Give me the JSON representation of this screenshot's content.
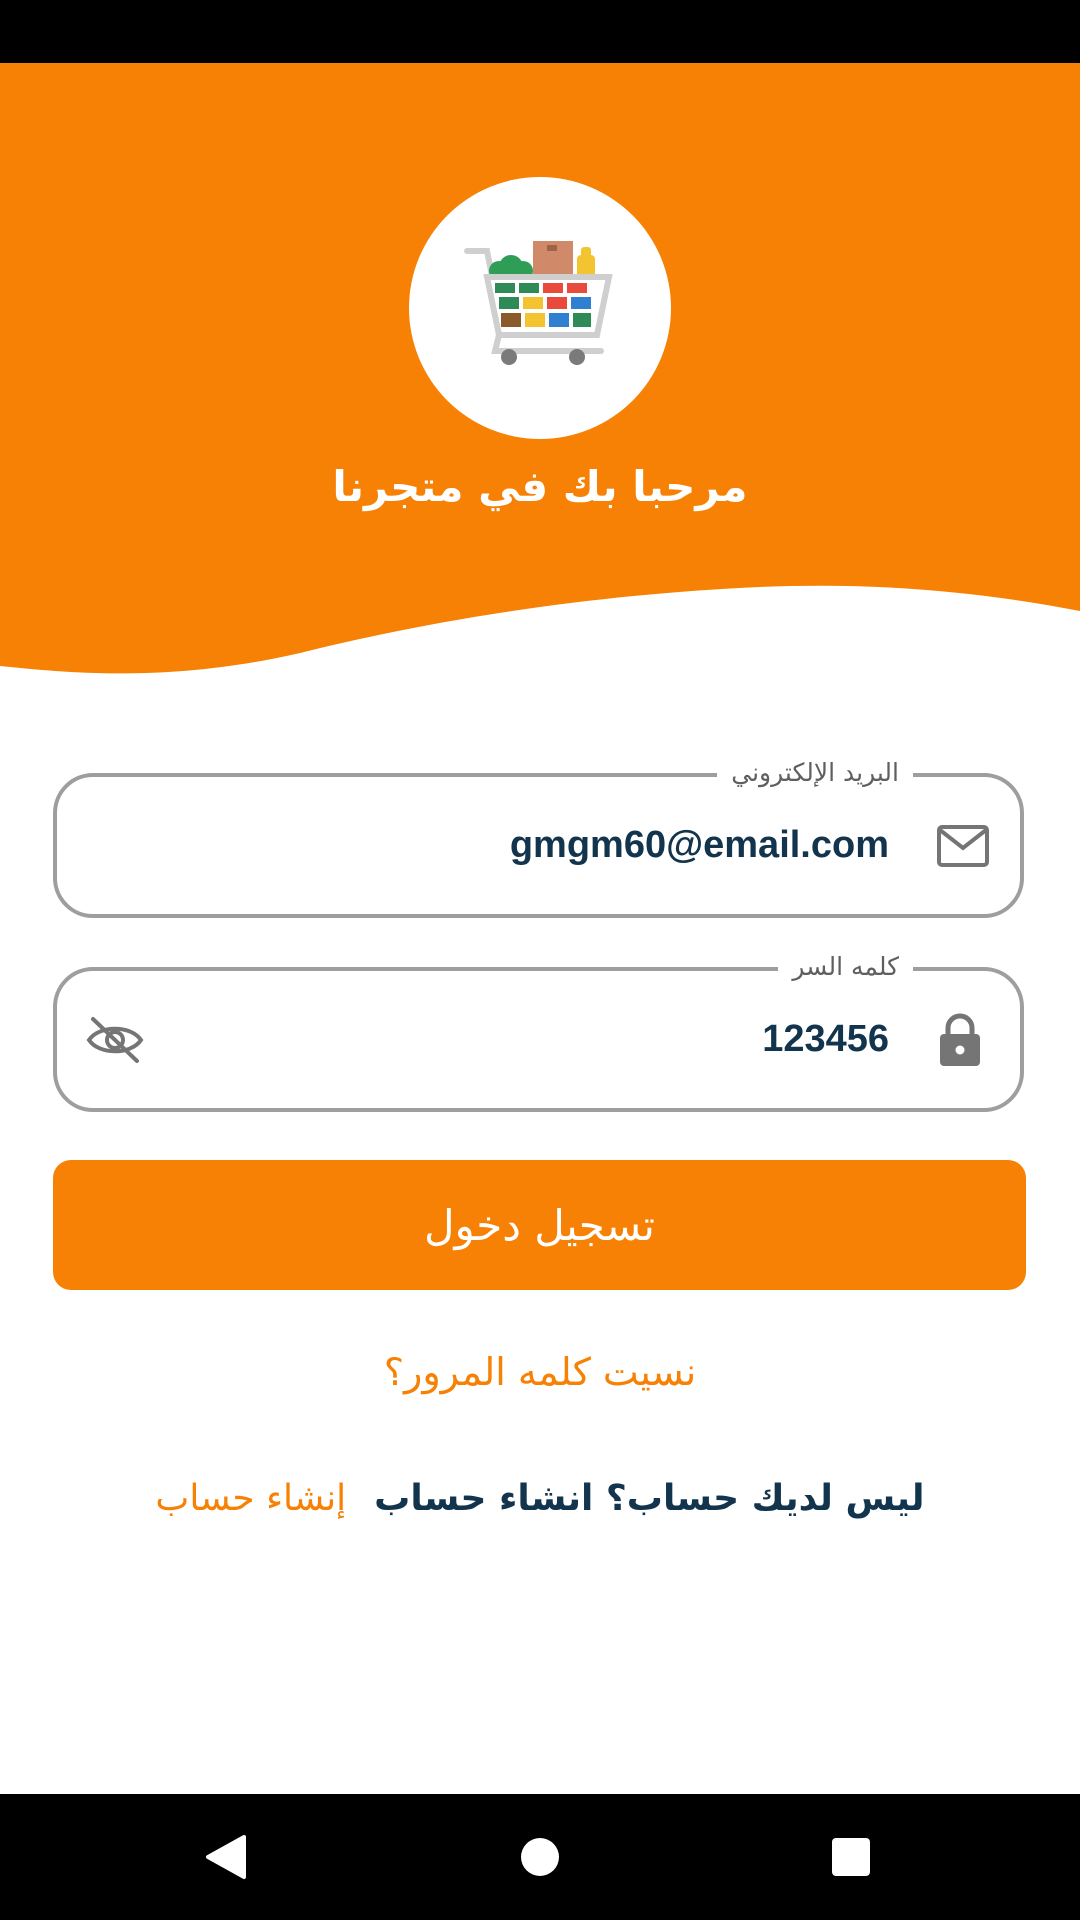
{
  "header": {
    "welcome_text": "مرحبا بك في متجرنا",
    "logo": "shopping-cart-logo"
  },
  "form": {
    "email": {
      "label": "البريد الإلكتروني",
      "value": "gmgm60@email.com",
      "icon": "mail-icon"
    },
    "password": {
      "label": "كلمه السر",
      "value": "123456",
      "icon": "lock-icon",
      "toggle_icon": "eye-off-icon"
    },
    "login_button": "تسجيل دخول",
    "forgot_password": "نسيت كلمه المرور؟",
    "signup_prompt": "ليس لديك حساب؟ انشاء حساب",
    "signup_link": "إنشاء حساب"
  },
  "colors": {
    "accent": "#f68104",
    "text_dark": "#12344d",
    "border": "#9e9e9e"
  },
  "nav": {
    "back": "back-icon",
    "home": "home-icon",
    "recents": "recents-icon"
  }
}
